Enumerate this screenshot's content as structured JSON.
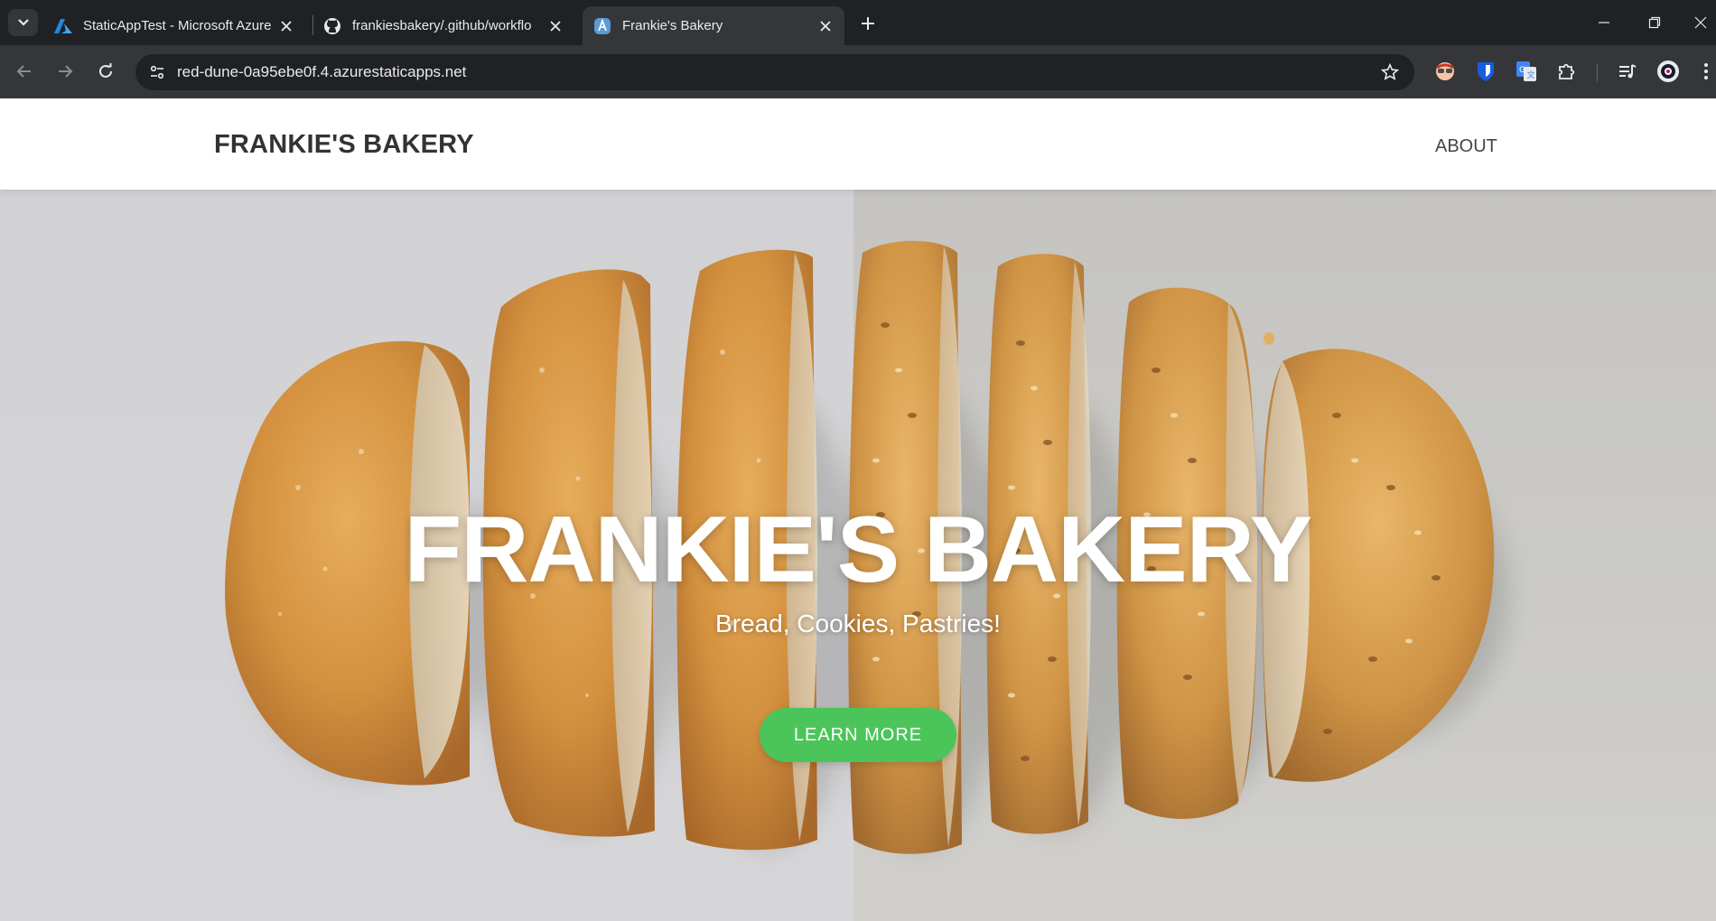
{
  "browser": {
    "tabs": [
      {
        "title": "StaticAppTest - Microsoft Azure",
        "icon": "azure-icon"
      },
      {
        "title": "frankiesbakery/.github/workflo",
        "icon": "github-icon"
      },
      {
        "title": "Frankie's Bakery",
        "icon": "static-web-apps-icon",
        "active": true
      }
    ],
    "url": "red-dune-0a95ebe0f.4.azurestaticapps.net"
  },
  "site": {
    "brand": "FRANKIE'S BAKERY",
    "nav": {
      "about": "ABOUT"
    },
    "hero": {
      "title": "FRANKIE'S BAKERY",
      "subtitle": "Bread, Cookies, Pastries!",
      "cta": "LEARN MORE"
    }
  },
  "colors": {
    "browser_bg": "#202124",
    "toolbar_bg": "#35363a",
    "cta_green": "#4bc559",
    "brand_text": "#333333"
  }
}
